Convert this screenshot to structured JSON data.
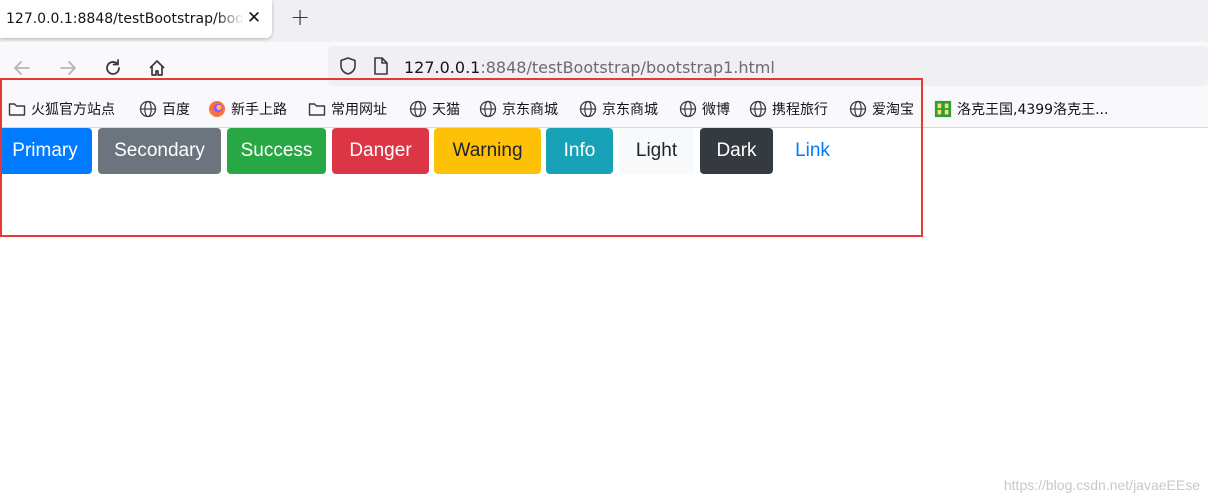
{
  "browser": {
    "tab_title": "127.0.0.1:8848/testBootstrap/boo",
    "tab_close": "✕",
    "new_tab": "+",
    "url_host": "127.0.0.1",
    "url_rest": ":8848/testBootstrap/bootstrap1.html"
  },
  "bookmarks": [
    {
      "label": "火狐官方站点",
      "icon": "folder-icon"
    },
    {
      "label": "百度",
      "icon": "globe-icon"
    },
    {
      "label": "新手上路",
      "icon": "firefox-icon"
    },
    {
      "label": "常用网址",
      "icon": "folder-icon"
    },
    {
      "label": "天猫",
      "icon": "globe-icon"
    },
    {
      "label": "京东商城",
      "icon": "globe-icon"
    },
    {
      "label": "京东商城",
      "icon": "globe-icon"
    },
    {
      "label": "微博",
      "icon": "globe-icon"
    },
    {
      "label": "携程旅行",
      "icon": "globe-icon"
    },
    {
      "label": "爱淘宝",
      "icon": "globe-icon"
    },
    {
      "label": "洛克王国,4399洛克王...",
      "icon": "4399-icon"
    }
  ],
  "buttons": [
    {
      "label": "Primary",
      "bg": "#007bff",
      "color": "#ffffff"
    },
    {
      "label": "Secondary",
      "bg": "#6c757d",
      "color": "#ffffff"
    },
    {
      "label": "Success",
      "bg": "#28a745",
      "color": "#ffffff"
    },
    {
      "label": "Danger",
      "bg": "#dc3545",
      "color": "#ffffff"
    },
    {
      "label": "Warning",
      "bg": "#ffc107",
      "color": "#212529"
    },
    {
      "label": "Info",
      "bg": "#17a2b8",
      "color": "#ffffff"
    },
    {
      "label": "Light",
      "bg": "#f8f9fa",
      "color": "#212529"
    },
    {
      "label": "Dark",
      "bg": "#343a40",
      "color": "#ffffff"
    },
    {
      "label": "Link",
      "bg": "transparent",
      "color": "#007bff"
    }
  ],
  "watermark": "https://blog.csdn.net/javaeEEse",
  "highlight_color": "#e53935"
}
